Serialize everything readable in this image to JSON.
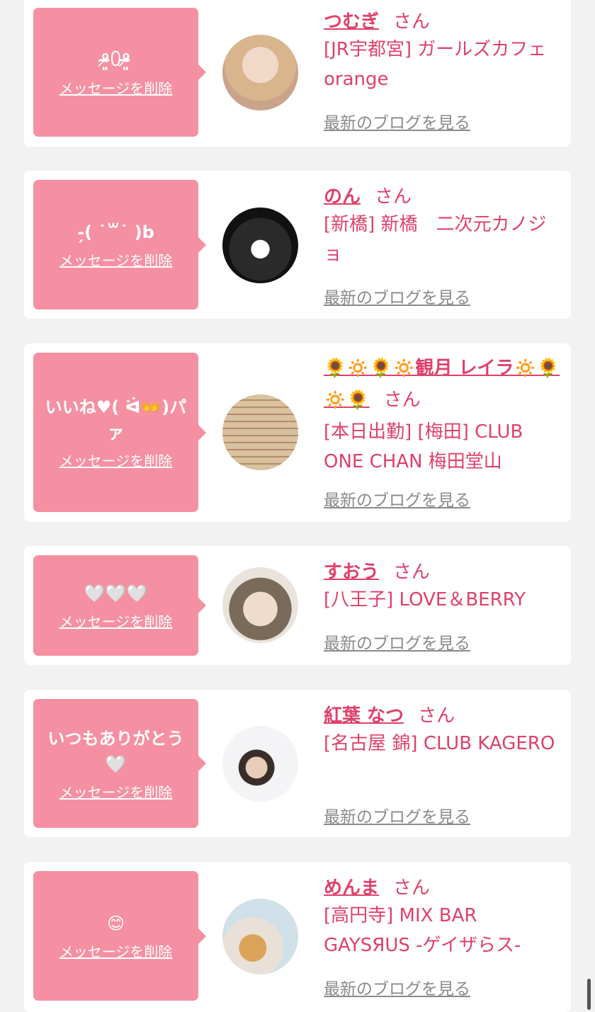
{
  "delete_label": "メッセージを削除",
  "blog_label": "最新のブログを見る",
  "san_label": "さん",
  "colors": {
    "accent": "#e0406a",
    "bubble": "#f590a2",
    "link_gray": "#8a8a8a"
  },
  "items": [
    {
      "message": "⁰̷̴͈꒨⁰̷̴͈",
      "name": "つむぎ",
      "shop": "[JR宇都宮] ガールズカフェ orange"
    },
    {
      "message": "-̗( ˙꒳˙ )b",
      "name": "のん",
      "shop": "[新橋] 新橋　二次元カノジョ"
    },
    {
      "message": "いいね♥( ᐛ👐)パァ",
      "name": "🌻🔅🌻🔅観月 レイラ🔅🌻🔅🌻",
      "shop": "[本日出勤] [梅田] CLUB ONE CHAN 梅田堂山"
    },
    {
      "message": "🤍🤍🤍",
      "name": "すおう",
      "shop": "[八王子] LOVE＆BERRY"
    },
    {
      "message": "いつもありがとう🤍",
      "name": "紅葉 なつ",
      "shop": "[名古屋 錦] CLUB KAGERO"
    },
    {
      "message": "😊",
      "name": "めんま",
      "shop": "[高円寺] MIX BAR GAYSЯUS -ゲイザらス-"
    }
  ]
}
